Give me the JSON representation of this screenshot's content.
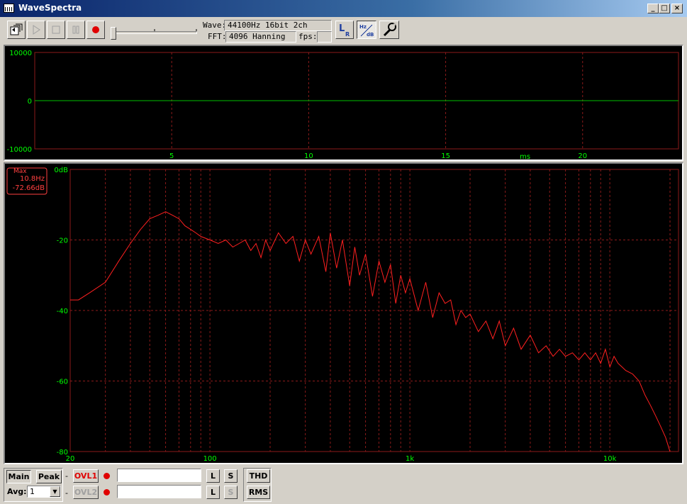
{
  "window": {
    "title": "WaveSpectra",
    "minimize_label": "_",
    "maximize_label": "□",
    "close_label": "×"
  },
  "toolbar": {
    "wave_label": "Wave:",
    "wave_value": "44100Hz 16bit 2ch",
    "fft_label": "FFT:",
    "fft_value": "4096 Hanning",
    "fps_label": "fps:",
    "fps_value": "",
    "lr_label": "L",
    "lr_sub": "R",
    "hzdb_top": "Hz",
    "hzdb_bottom": "dB"
  },
  "wave_chart": {
    "y_ticks": [
      "10000",
      "0",
      "-10000"
    ],
    "x_ticks": [
      "5",
      "10",
      "15",
      "20"
    ],
    "x_unit": "ms"
  },
  "spectrum_chart": {
    "y_ticks": [
      "0dB",
      "-20",
      "-40",
      "-60",
      "-80"
    ],
    "x_ticks": [
      "20",
      "100",
      "1k",
      "10k"
    ],
    "max_box": {
      "label": "Max",
      "freq": "10.8Hz",
      "level": "-72.66dB"
    }
  },
  "colors": {
    "grid": "#8b1a1a",
    "wave_trace": "#00c000",
    "wave_tick": "#00ff00",
    "spectrum_trace": "#ff2020",
    "spectrum_tick": "#00ff00",
    "max_box": "#ff4040"
  },
  "chart_data": [
    {
      "type": "line",
      "x_unit": "ms",
      "xlim": [
        0,
        23.5
      ],
      "ylim": [
        -10000,
        10000
      ],
      "grid": true,
      "series": [
        {
          "x": [
            0,
            23.5
          ],
          "y": [
            0,
            0
          ]
        }
      ]
    },
    {
      "type": "line",
      "x_scale": "log",
      "xlim": [
        20,
        22050
      ],
      "ylim": [
        -80,
        0
      ],
      "grid": true,
      "series": [
        {
          "x": [
            20,
            22,
            25,
            30,
            35,
            40,
            45,
            50,
            55,
            60,
            65,
            70,
            75,
            80,
            85,
            90,
            100,
            110,
            120,
            130,
            140,
            150,
            160,
            170,
            180,
            190,
            200,
            220,
            240,
            260,
            280,
            300,
            320,
            350,
            380,
            400,
            430,
            460,
            500,
            530,
            560,
            600,
            650,
            700,
            750,
            800,
            850,
            900,
            950,
            1000,
            1100,
            1200,
            1300,
            1400,
            1500,
            1600,
            1700,
            1800,
            1900,
            2000,
            2200,
            2400,
            2600,
            2800,
            3000,
            3300,
            3600,
            4000,
            4400,
            4800,
            5200,
            5600,
            6000,
            6500,
            7000,
            7500,
            8000,
            8500,
            9000,
            9500,
            10000,
            10500,
            11000,
            11500,
            12000,
            13000,
            14000,
            15000,
            16000,
            17000,
            18000,
            19000,
            20000
          ],
          "y": [
            -37,
            -37,
            -35,
            -32,
            -26,
            -21,
            -17,
            -14,
            -13,
            -12,
            -13,
            -14,
            -16,
            -17,
            -18,
            -19,
            -20,
            -21,
            -20,
            -22,
            -21,
            -20,
            -23,
            -21,
            -25,
            -20,
            -23,
            -18,
            -21,
            -19,
            -26,
            -20,
            -24,
            -19,
            -29,
            -18,
            -28,
            -20,
            -33,
            -22,
            -30,
            -24,
            -36,
            -26,
            -32,
            -27,
            -38,
            -30,
            -35,
            -31,
            -40,
            -32,
            -42,
            -35,
            -38,
            -37,
            -44,
            -40,
            -42,
            -41,
            -46,
            -43,
            -48,
            -43,
            -50,
            -45,
            -51,
            -47,
            -52,
            -50,
            -53,
            -51,
            -53,
            -52,
            -54,
            -52,
            -54,
            -52,
            -55,
            -51,
            -56,
            -53,
            -55,
            -56,
            -57,
            -58,
            -60,
            -64,
            -67,
            -70,
            -73,
            -76,
            -80
          ]
        }
      ]
    }
  ],
  "bottom": {
    "main_label": "Main",
    "peak_label": "Peak",
    "avg_label": "Avg:",
    "avg_value": "1",
    "dash": "-",
    "ovl1_label": "OVL1",
    "ovl2_label": "OVL2",
    "l_label": "L",
    "s_label": "S",
    "thd_label": "THD",
    "rms_label": "RMS"
  }
}
